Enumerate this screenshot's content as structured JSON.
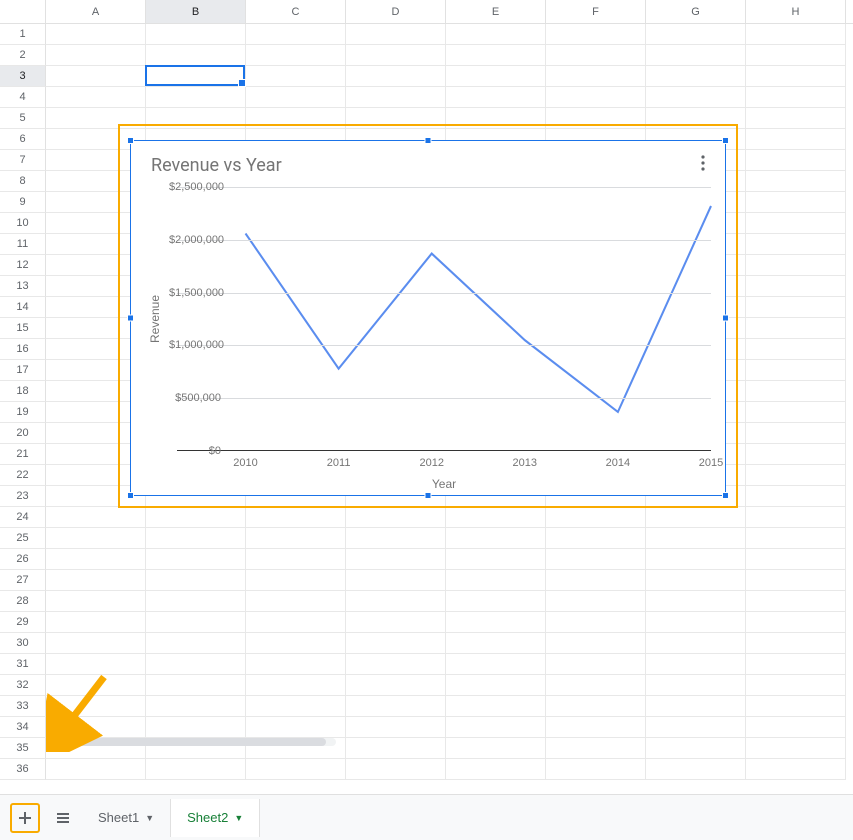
{
  "grid": {
    "columns": [
      "A",
      "B",
      "C",
      "D",
      "E",
      "F",
      "G",
      "H"
    ],
    "rows_visible": 36,
    "active_cell": "B3",
    "active_col_index": 1,
    "active_row_index": 2
  },
  "tabs": {
    "items": [
      {
        "label": "Sheet1",
        "active": false
      },
      {
        "label": "Sheet2",
        "active": true
      }
    ]
  },
  "chart_data": {
    "type": "line",
    "title": "Revenue vs Year",
    "xlabel": "Year",
    "ylabel": "Revenue",
    "x": [
      2010,
      2011,
      2012,
      2013,
      2014,
      2015
    ],
    "series": [
      {
        "name": "Revenue",
        "values": [
          2060000,
          780000,
          1870000,
          1050000,
          370000,
          2320000
        ],
        "color": "#5b8def"
      }
    ],
    "ylim": [
      0,
      2500000
    ],
    "y_ticks": [
      0,
      500000,
      1000000,
      1500000,
      2000000,
      2500000
    ],
    "y_tick_labels": [
      "$0",
      "$500,000",
      "$1,000,000",
      "$1,500,000",
      "$2,000,000",
      "$2,500,000"
    ]
  },
  "colors": {
    "selection_blue": "#1a73e8",
    "accent_orange": "#f9ab00",
    "active_tab_green": "#188038"
  }
}
